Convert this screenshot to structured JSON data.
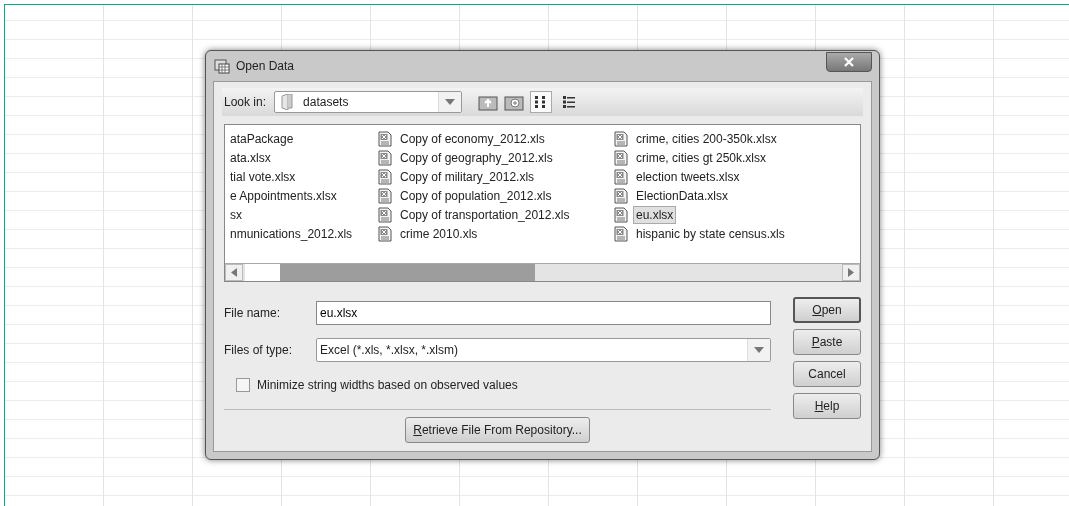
{
  "window": {
    "title": "Open Data"
  },
  "toolbar": {
    "look_in_label": "Look in:",
    "folder": "datasets",
    "views": [
      {
        "kind": "list",
        "selected": true
      },
      {
        "kind": "details",
        "selected": false
      }
    ]
  },
  "files": [
    {
      "name": "ataPackage",
      "icon": false,
      "selected": false
    },
    {
      "name": "ata.xlsx",
      "icon": false,
      "selected": false
    },
    {
      "name": "tial vote.xlsx",
      "icon": false,
      "selected": false
    },
    {
      "name": "e Appointments.xlsx",
      "icon": false,
      "selected": false
    },
    {
      "name": "sx",
      "icon": false,
      "selected": false
    },
    {
      "name": "nmunications_2012.xls",
      "icon": false,
      "selected": false
    },
    {
      "name": "Copy of economy_2012.xls",
      "icon": true,
      "selected": false
    },
    {
      "name": "Copy of geography_2012.xls",
      "icon": true,
      "selected": false
    },
    {
      "name": "Copy of military_2012.xls",
      "icon": true,
      "selected": false
    },
    {
      "name": "Copy of population_2012.xls",
      "icon": true,
      "selected": false
    },
    {
      "name": "Copy of transportation_2012.xls",
      "icon": true,
      "selected": false
    },
    {
      "name": "crime 2010.xls",
      "icon": true,
      "selected": false
    },
    {
      "name": "crime, cities 200-350k.xlsx",
      "icon": true,
      "selected": false
    },
    {
      "name": "crime, cities gt 250k.xlsx",
      "icon": true,
      "selected": false
    },
    {
      "name": "election tweets.xlsx",
      "icon": true,
      "selected": false
    },
    {
      "name": "ElectionData.xlsx",
      "icon": true,
      "selected": false
    },
    {
      "name": "eu.xlsx",
      "icon": true,
      "selected": true
    },
    {
      "name": "hispanic by state census.xls",
      "icon": true,
      "selected": false
    }
  ],
  "file_name": {
    "label": "File name:",
    "value": "eu.xlsx"
  },
  "file_type": {
    "label": "Files of type:",
    "value": "Excel (*.xls, *.xlsx, *.xlsm)"
  },
  "minimize_option": {
    "label": "Minimize string widths based on observed values",
    "checked": false
  },
  "retrieve_button": {
    "accel": "R",
    "text": "etrieve File From Repository..."
  },
  "buttons": [
    {
      "accel": "O",
      "text": "pen",
      "default": true
    },
    {
      "accel": "P",
      "text": "aste",
      "default": false
    },
    {
      "text": "Cancel",
      "default": false
    },
    {
      "accel": "H",
      "text": "elp",
      "default": false
    }
  ]
}
